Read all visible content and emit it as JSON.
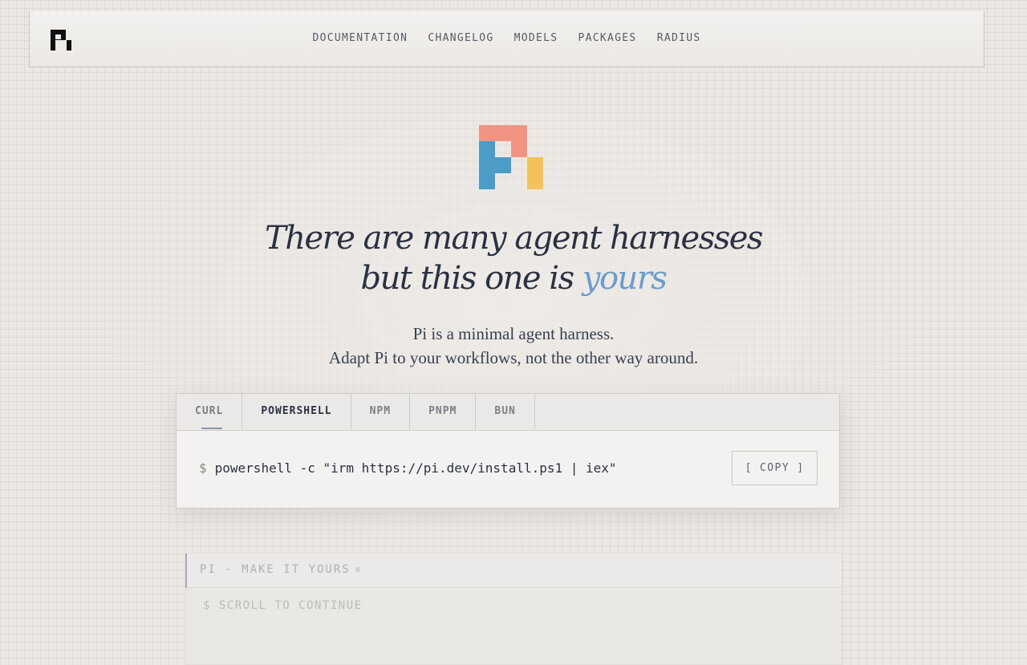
{
  "nav": {
    "items": [
      "DOCUMENTATION",
      "CHANGELOG",
      "MODELS",
      "PACKAGES",
      "RADIUS"
    ]
  },
  "hero": {
    "headline_line1": "There are many agent harnesses",
    "headline_line2_prefix": "but this one is",
    "headline_accent": "yours",
    "subtitle_line1": "Pi is a minimal agent harness.",
    "subtitle_line2": "Adapt Pi to your workflows, not the other way around."
  },
  "install": {
    "tabs": [
      "CURL",
      "POWERSHELL",
      "NPM",
      "PNPM",
      "BUN"
    ],
    "active_tab": "POWERSHELL",
    "prompt": "$",
    "command": "powershell -c \"irm https://pi.dev/install.ps1 | iex\"",
    "copy_open": "[",
    "copy_label": "COPY",
    "copy_close": "]"
  },
  "terminal": {
    "title": "PI - MAKE IT YOURS",
    "line": "$ SCROLL TO CONTINUE"
  },
  "colors": {
    "logo_coral": "#f29483",
    "logo_blue": "#4b9dc7",
    "logo_yellow": "#f4c25b",
    "accent": "#6b9ccc",
    "text_dark": "#2a3142"
  },
  "icons": {
    "nav_logo": "pi-logo-icon",
    "hero_logo": "pi-color-logo-icon"
  }
}
